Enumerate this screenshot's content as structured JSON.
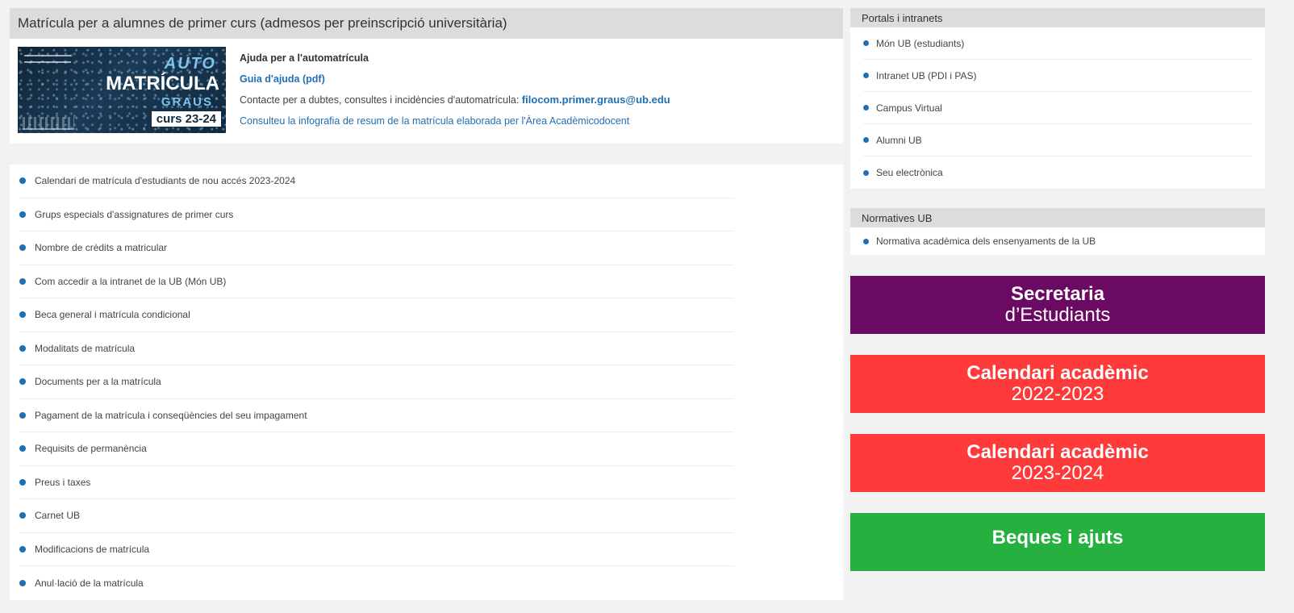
{
  "matricula": {
    "header_title": "Matrícula per a alumnes de primer curs (admesos per preinscripció universitària)",
    "banner": {
      "auto": "AUTO",
      "matricula": "MATRÍCULA",
      "graus": "GRAUS",
      "curs": "curs 23-24"
    },
    "help_title": "Ajuda per a l'automatrícula",
    "guide_link": "Guia d'ajuda (pdf)",
    "contact_text": "Contacte per a dubtes, consultes i incidències d'automatrícula:",
    "contact_email": "filocom.primer.graus@ub.edu",
    "infographic_link": "Consulteu la infografia de resum de la matrícula elaborada per l'Àrea Acadèmicodocent"
  },
  "links": [
    "Calendari de matrícula d'estudiants de nou accés 2023-2024",
    "Grups especials d'assignatures de primer curs",
    "Nombre de crèdits a matricular",
    "Com accedir a la intranet de la UB (Món UB)",
    "Beca general i matrícula condicional",
    "Modalitats de matrícula",
    "Documents per a la matrícula",
    "Pagament de la matrícula i conseqüències del seu impagament",
    "Requisits de permanència",
    "Preus i taxes",
    "Carnet UB",
    "Modificacions de matrícula",
    "Anul·lació de la matrícula"
  ],
  "portals": {
    "header": "Portals i intranets",
    "items": [
      "Món UB (estudiants)",
      "Intranet UB (PDI i PAS)",
      "Campus Virtual",
      "Alumni UB",
      "Seu electrònica"
    ]
  },
  "normatives": {
    "header": "Normatives UB",
    "items": [
      "Normativa acadèmica dels ensenyaments de la UB"
    ]
  },
  "promos": {
    "secretaria": {
      "line1": "Secretaria",
      "line2": "d’Estudiants"
    },
    "calendari_2022": {
      "line1": "Calendari acadèmic",
      "line2": "2022-2023"
    },
    "calendari_2023": {
      "line1": "Calendari acadèmic",
      "line2": "2023-2024"
    },
    "beques": {
      "line1": "Beques i ajuts"
    }
  },
  "colors": {
    "accent_blue": "#1f6fb4",
    "secretaria": "#6a0a63",
    "calendari": "#ff3a3a",
    "beques": "#26b040"
  }
}
